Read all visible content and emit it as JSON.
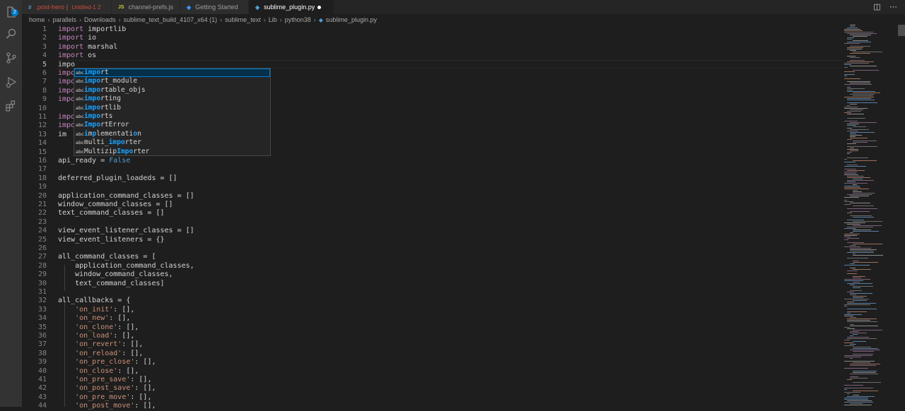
{
  "activity_bar": {
    "explorer_badge": "2",
    "icons": [
      "files-icon",
      "search-icon",
      "source-control-icon",
      "run-debug-icon",
      "extensions-icon"
    ]
  },
  "tabs": [
    {
      "icon": "#",
      "label": ".post-hero {",
      "extra": "Untitled-1  2",
      "icon_color": "#519aba",
      "label_color": "#c74e39",
      "active": false
    },
    {
      "icon": "JS",
      "label": "channel-prefs.js",
      "extra": "",
      "icon_color": "#cbcb41",
      "label_color": "#9d9d9d",
      "active": false
    },
    {
      "icon": "◆",
      "label": "Getting Started",
      "extra": "",
      "icon_color": "#3794ff",
      "label_color": "#9d9d9d",
      "active": false
    },
    {
      "icon": "◆",
      "label": "sublime_plugin.py",
      "extra": "",
      "icon_color": "#4d9fd6",
      "label_color": "#ffffff",
      "active": true,
      "dirty": true
    }
  ],
  "breadcrumb": [
    "home",
    "parallels",
    "Downloads",
    "sublime_text_build_4107_x64 (1)",
    "sublime_text",
    "Lib",
    "python38",
    "sublime_plugin.py"
  ],
  "editor": {
    "current_line": 5,
    "lines": [
      {
        "n": "1",
        "tokens": [
          [
            "kw",
            "import"
          ],
          [
            "var",
            " importlib"
          ]
        ]
      },
      {
        "n": "2",
        "tokens": [
          [
            "kw",
            "import"
          ],
          [
            "var",
            " io"
          ]
        ]
      },
      {
        "n": "3",
        "tokens": [
          [
            "kw",
            "import"
          ],
          [
            "var",
            " marshal"
          ]
        ]
      },
      {
        "n": "4",
        "tokens": [
          [
            "kw",
            "import"
          ],
          [
            "var",
            " os"
          ]
        ]
      },
      {
        "n": "5",
        "tokens": [
          [
            "var",
            "impo"
          ]
        ]
      },
      {
        "n": "6",
        "tokens": [
          [
            "kw",
            "impo"
          ]
        ]
      },
      {
        "n": "7",
        "tokens": [
          [
            "kw",
            "impo"
          ]
        ]
      },
      {
        "n": "8",
        "tokens": [
          [
            "kw",
            "impo"
          ]
        ]
      },
      {
        "n": "9",
        "tokens": [
          [
            "kw",
            "impo"
          ]
        ]
      },
      {
        "n": "10",
        "tokens": []
      },
      {
        "n": "11",
        "tokens": [
          [
            "kw",
            "impo"
          ]
        ]
      },
      {
        "n": "12",
        "tokens": [
          [
            "kw",
            "impo"
          ]
        ]
      },
      {
        "n": "13",
        "tokens": [
          [
            "var",
            "im"
          ]
        ]
      },
      {
        "n": "14",
        "tokens": []
      },
      {
        "n": "15",
        "tokens": []
      },
      {
        "n": "16",
        "tokens": [
          [
            "var",
            "api_ready = "
          ],
          [
            "bool",
            "False"
          ]
        ]
      },
      {
        "n": "17",
        "tokens": []
      },
      {
        "n": "18",
        "tokens": [
          [
            "var",
            "deferred_plugin_loadeds = []"
          ]
        ]
      },
      {
        "n": "19",
        "tokens": []
      },
      {
        "n": "20",
        "tokens": [
          [
            "var",
            "application_command_classes = []"
          ]
        ]
      },
      {
        "n": "21",
        "tokens": [
          [
            "var",
            "window_command_classes = []"
          ]
        ]
      },
      {
        "n": "22",
        "tokens": [
          [
            "var",
            "text_command_classes = []"
          ]
        ]
      },
      {
        "n": "23",
        "tokens": []
      },
      {
        "n": "24",
        "tokens": [
          [
            "var",
            "view_event_listener_classes = []"
          ]
        ]
      },
      {
        "n": "25",
        "tokens": [
          [
            "var",
            "view_event_listeners = {}"
          ]
        ]
      },
      {
        "n": "26",
        "tokens": []
      },
      {
        "n": "27",
        "tokens": [
          [
            "var",
            "all_command_classes = ["
          ]
        ]
      },
      {
        "n": "28",
        "tokens": [
          [
            "var",
            "    application_command_classes,"
          ]
        ]
      },
      {
        "n": "29",
        "tokens": [
          [
            "var",
            "    window_command_classes,"
          ]
        ]
      },
      {
        "n": "30",
        "tokens": [
          [
            "var",
            "    text_command_classes]"
          ]
        ]
      },
      {
        "n": "31",
        "tokens": []
      },
      {
        "n": "32",
        "tokens": [
          [
            "var",
            "all_callbacks = {"
          ]
        ]
      },
      {
        "n": "33",
        "tokens": [
          [
            "var",
            "    "
          ],
          [
            "str",
            "'on_init'"
          ],
          [
            "var",
            ": [],"
          ]
        ]
      },
      {
        "n": "34",
        "tokens": [
          [
            "var",
            "    "
          ],
          [
            "str",
            "'on_new'"
          ],
          [
            "var",
            ": [],"
          ]
        ]
      },
      {
        "n": "35",
        "tokens": [
          [
            "var",
            "    "
          ],
          [
            "str",
            "'on_clone'"
          ],
          [
            "var",
            ": [],"
          ]
        ]
      },
      {
        "n": "36",
        "tokens": [
          [
            "var",
            "    "
          ],
          [
            "str",
            "'on_load'"
          ],
          [
            "var",
            ": [],"
          ]
        ]
      },
      {
        "n": "37",
        "tokens": [
          [
            "var",
            "    "
          ],
          [
            "str",
            "'on_revert'"
          ],
          [
            "var",
            ": [],"
          ]
        ]
      },
      {
        "n": "38",
        "tokens": [
          [
            "var",
            "    "
          ],
          [
            "str",
            "'on_reload'"
          ],
          [
            "var",
            ": [],"
          ]
        ]
      },
      {
        "n": "39",
        "tokens": [
          [
            "var",
            "    "
          ],
          [
            "str",
            "'on_pre_close'"
          ],
          [
            "var",
            ": [],"
          ]
        ]
      },
      {
        "n": "40",
        "tokens": [
          [
            "var",
            "    "
          ],
          [
            "str",
            "'on_close'"
          ],
          [
            "var",
            ": [],"
          ]
        ]
      },
      {
        "n": "41",
        "tokens": [
          [
            "var",
            "    "
          ],
          [
            "str",
            "'on_pre_save'"
          ],
          [
            "var",
            ": [],"
          ]
        ]
      },
      {
        "n": "42",
        "tokens": [
          [
            "var",
            "    "
          ],
          [
            "str",
            "'on_post_save'"
          ],
          [
            "var",
            ": [],"
          ]
        ]
      },
      {
        "n": "43",
        "tokens": [
          [
            "var",
            "    "
          ],
          [
            "str",
            "'on_pre_move'"
          ],
          [
            "var",
            ": [],"
          ]
        ]
      },
      {
        "n": "44",
        "tokens": [
          [
            "var",
            "    "
          ],
          [
            "str",
            "'on_post_move'"
          ],
          [
            "var",
            ": [],"
          ]
        ]
      }
    ]
  },
  "suggestions": {
    "kind_label": "abc",
    "items": [
      {
        "parts": [
          [
            "hl",
            "impo"
          ],
          [
            "n",
            "rt"
          ]
        ],
        "selected": true
      },
      {
        "parts": [
          [
            "hl",
            "impo"
          ],
          [
            "n",
            "rt_module"
          ]
        ]
      },
      {
        "parts": [
          [
            "hl",
            "impo"
          ],
          [
            "n",
            "rtable_objs"
          ]
        ]
      },
      {
        "parts": [
          [
            "hl",
            "impo"
          ],
          [
            "n",
            "rting"
          ]
        ]
      },
      {
        "parts": [
          [
            "hl",
            "impo"
          ],
          [
            "n",
            "rtlib"
          ]
        ]
      },
      {
        "parts": [
          [
            "hl",
            "impo"
          ],
          [
            "n",
            "rts"
          ]
        ]
      },
      {
        "parts": [
          [
            "hl",
            "Impo"
          ],
          [
            "n",
            "rtError"
          ]
        ]
      },
      {
        "parts": [
          [
            "hl",
            "i"
          ],
          [
            "n",
            "m"
          ],
          [
            "hl",
            "p"
          ],
          [
            "n",
            "lementati"
          ],
          [
            "hl",
            "o"
          ],
          [
            "n",
            "n"
          ]
        ]
      },
      {
        "parts": [
          [
            "n",
            "multi_"
          ],
          [
            "hl",
            "impo"
          ],
          [
            "n",
            "rter"
          ]
        ]
      },
      {
        "parts": [
          [
            "n",
            "Multizip"
          ],
          [
            "hl",
            "Impo"
          ],
          [
            "n",
            "rter"
          ]
        ]
      }
    ]
  }
}
